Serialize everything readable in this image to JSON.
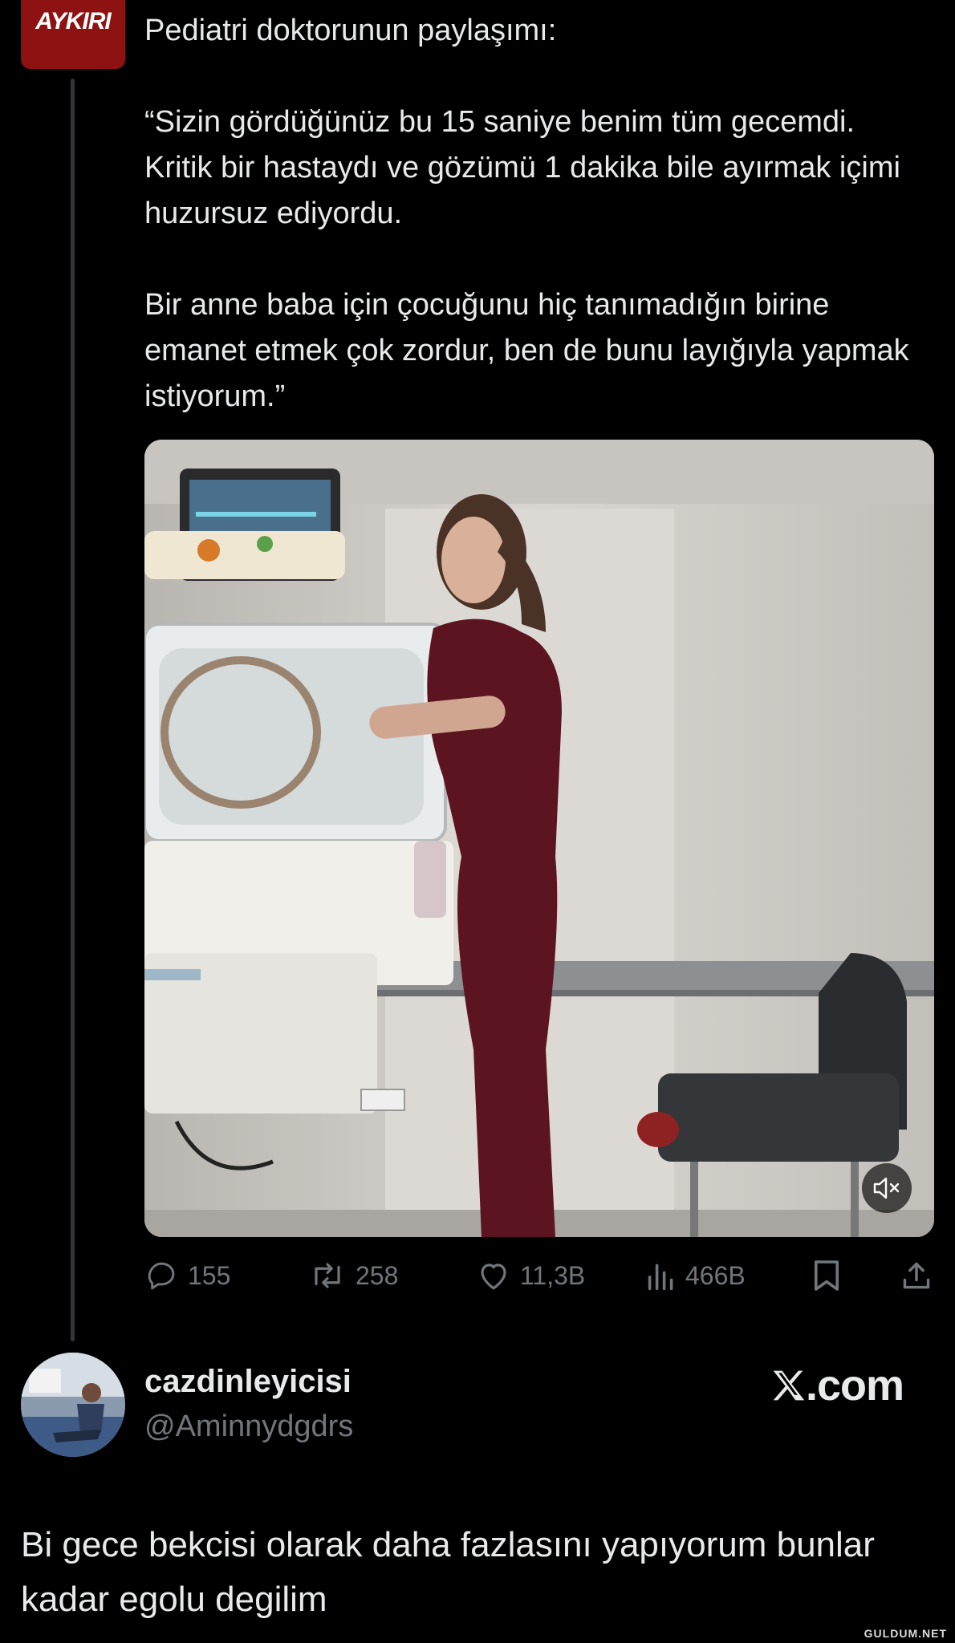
{
  "source_logo": {
    "text": "AYKIRI",
    "color": "#8e1212"
  },
  "tweet": {
    "paragraphs": [
      "Pediatri doktorunun paylaşımı:",
      "“Sizin gördüğünüz bu 15 saniye benim tüm gecemdi. Kritik bir hastaydı ve gözümü 1 dakika bile ayırmak içimi huzursuz ediyordu.",
      "Bir anne baba için çocuğunu hiç tanımadığın birine emanet etmek çok zordur, ben de bunu layığıyla yapmak istiyorum.”"
    ],
    "media": {
      "type": "video",
      "icon": "muted-speaker-icon"
    },
    "actions": {
      "replies": "155",
      "reposts": "258",
      "likes": "11,3B",
      "views": "466B"
    }
  },
  "reply": {
    "display_name": "cazdinleyicisi",
    "handle": "@Aminnydgdrs",
    "text": "Bi gece bekcisi olarak daha fazlasını yapıyorum bunlar kadar egolu degilim"
  },
  "brand": {
    "x_com_suffix": ".com"
  },
  "watermark": "GULDUM.NET"
}
